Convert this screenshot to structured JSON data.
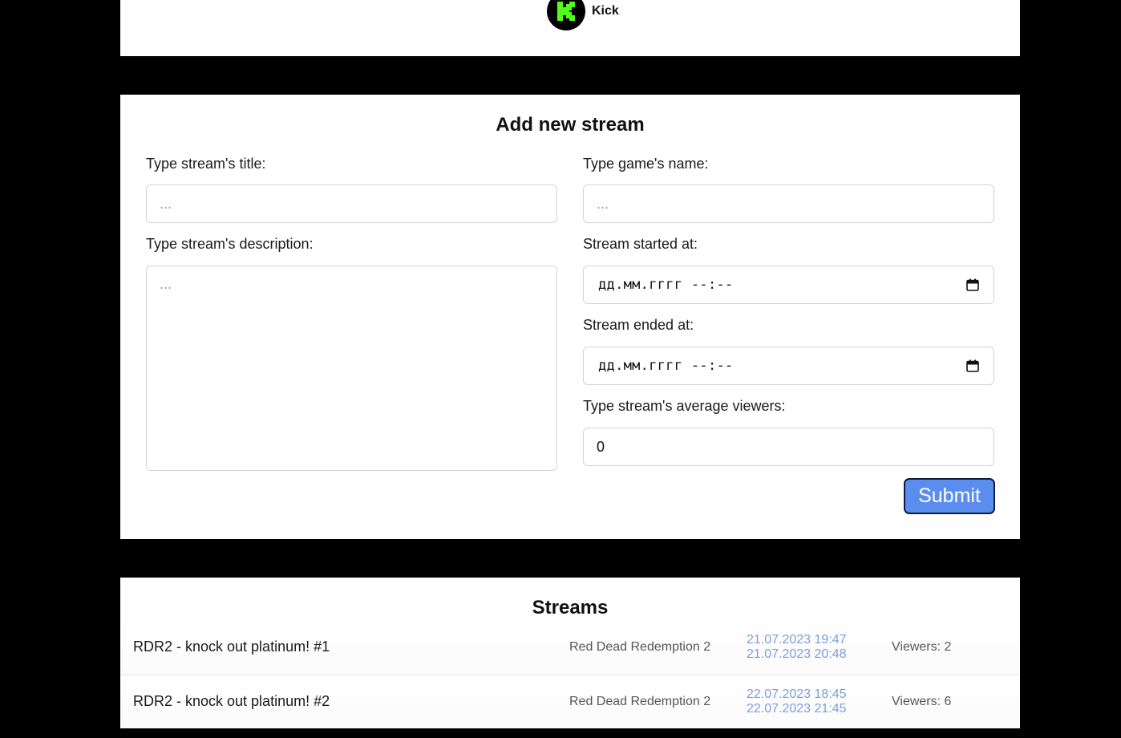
{
  "platform": {
    "name": "Kick",
    "logo_letter": "K",
    "brand_color": "#53fc18"
  },
  "form": {
    "title": "Add new stream",
    "title_label": "Type stream's title:",
    "title_placeholder": "...",
    "game_label": "Type game's name:",
    "game_placeholder": "...",
    "description_label": "Type stream's description:",
    "description_placeholder": "...",
    "started_label": "Stream started at:",
    "started_value": "дд.мм.гггг --:--",
    "ended_label": "Stream ended at:",
    "ended_value": "дд.мм.гггг --:--",
    "viewers_label": "Type stream's average viewers:",
    "viewers_value": "0",
    "submit_label": "Submit",
    "submit_color": "#5b8def"
  },
  "streams": {
    "title": "Streams",
    "items": [
      {
        "title": "RDR2 - knock out platinum! #1",
        "game": "Red Dead Redemption 2",
        "started": "21.07.2023 19:47",
        "ended": "21.07.2023 20:48",
        "viewers": "Viewers: 2"
      },
      {
        "title": "RDR2 - knock out platinum! #2",
        "game": "Red Dead Redemption 2",
        "started": "22.07.2023 18:45",
        "ended": "22.07.2023 21:45",
        "viewers": "Viewers: 6"
      }
    ],
    "date_color": "#7a9edc"
  }
}
